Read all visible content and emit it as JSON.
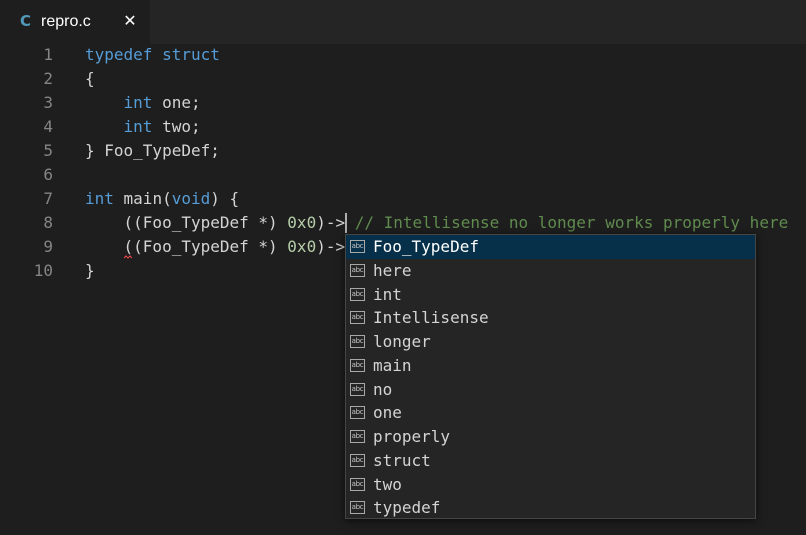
{
  "tab": {
    "lang_icon": "C",
    "filename": "repro.c",
    "close_glyph": "✕"
  },
  "colors": {
    "keyword": "#569cd6",
    "number": "#b5cea8",
    "comment": "#608b4e",
    "text": "#d4d4d4",
    "line_number": "#858585",
    "selection": "#062f4a"
  },
  "editor": {
    "lines": [
      {
        "n": "1",
        "t": [
          {
            "k": "kw",
            "s": "typedef struct"
          }
        ]
      },
      {
        "n": "2",
        "t": [
          {
            "k": "",
            "s": "{"
          }
        ]
      },
      {
        "n": "3",
        "t": [
          {
            "k": "",
            "s": "    "
          },
          {
            "k": "kw",
            "s": "int"
          },
          {
            "k": "",
            "s": " one;"
          }
        ]
      },
      {
        "n": "4",
        "t": [
          {
            "k": "",
            "s": "    "
          },
          {
            "k": "kw",
            "s": "int"
          },
          {
            "k": "",
            "s": " two;"
          }
        ]
      },
      {
        "n": "5",
        "t": [
          {
            "k": "",
            "s": "} Foo_TypeDef;"
          }
        ]
      },
      {
        "n": "6",
        "t": []
      },
      {
        "n": "7",
        "t": [
          {
            "k": "kw",
            "s": "int"
          },
          {
            "k": "",
            "s": " main("
          },
          {
            "k": "kw",
            "s": "void"
          },
          {
            "k": "",
            "s": ") {"
          }
        ]
      },
      {
        "n": "8",
        "t": [
          {
            "k": "",
            "s": "    ((Foo_TypeDef *) "
          },
          {
            "k": "num",
            "s": "0x0"
          },
          {
            "k": "",
            "s": ")-> "
          },
          {
            "k": "cmt",
            "s": "// Intellisense no longer works properly here"
          }
        ]
      },
      {
        "n": "9",
        "t": [
          {
            "k": "",
            "s": "    ((Foo_TypeDef *) "
          },
          {
            "k": "num",
            "s": "0x0"
          },
          {
            "k": "",
            "s": ")->"
          }
        ]
      },
      {
        "n": "10",
        "t": [
          {
            "k": "",
            "s": "}"
          }
        ]
      }
    ]
  },
  "suggest": {
    "icon_text": "abc",
    "icon_name": "word-icon",
    "selected_index": 0,
    "items": [
      "Foo_TypeDef",
      "here",
      "int",
      "Intellisense",
      "longer",
      "main",
      "no",
      "one",
      "properly",
      "struct",
      "two",
      "typedef"
    ]
  }
}
